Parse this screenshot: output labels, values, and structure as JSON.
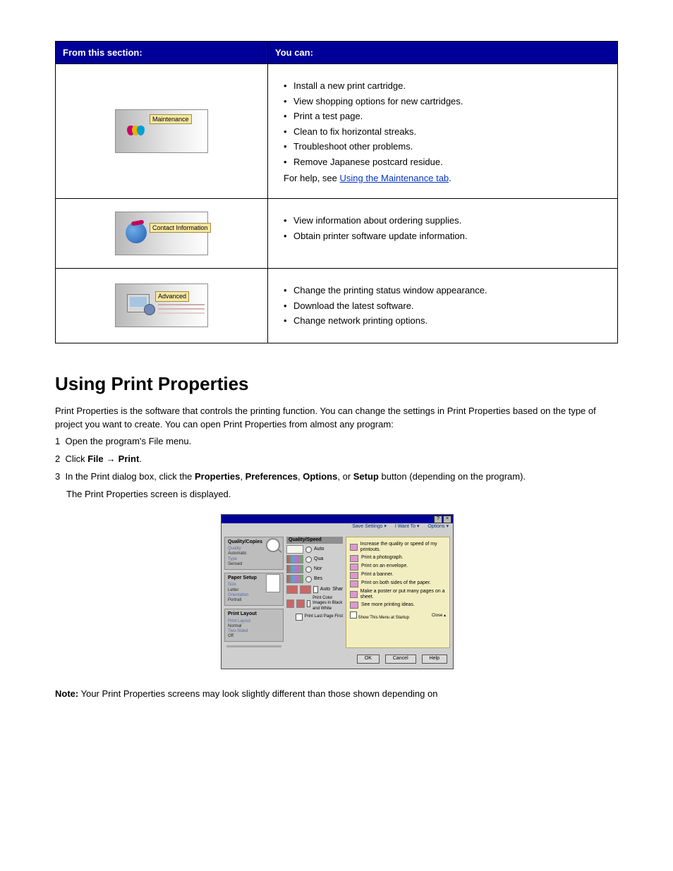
{
  "table": {
    "header": {
      "from": "From this section:",
      "can": "You can:"
    },
    "rows": [
      {
        "icon": "maintenance-icon",
        "label": "Maintenance",
        "items": [
          "Install a new print cartridge.",
          "View shopping options for new cartridges.",
          "Print a test page.",
          "Clean to fix horizontal streaks.",
          "Troubleshoot other problems.",
          "Remove Japanese postcard residue."
        ],
        "helpNote": "For help, see ",
        "helpLink": "Using the Maintenance tab"
      },
      {
        "icon": "contact-information-icon",
        "label": "Contact Information",
        "items": [
          "View information about ordering supplies.",
          "Obtain printer software update information."
        ]
      },
      {
        "icon": "advanced-icon",
        "label": "Advanced",
        "items": [
          "Change the printing status window appearance.",
          "Download the latest software.",
          "Change network printing options."
        ]
      }
    ]
  },
  "sectionTitle": "Using Print Properties",
  "paragraph1": "Print Properties is the software that controls the printing function. You can change the settings in Print Properties based on the type of project you want to create. You can open Print Properties from almost any program:",
  "steps": {
    "s1_label": "1",
    "s1_text": "Open the program's File menu.",
    "s2_label": "2",
    "s2_text_a": "Click ",
    "s2_text_b": "File",
    "s2_arrow": "→",
    "s2_text_c": "Print",
    "s2_text_d": ".",
    "s3_label": "3",
    "s3_text_a": "In the Print dialog box, click the ",
    "s3_text_b": "Properties",
    "s3_text_c": ", ",
    "s3_text_d": "Preferences",
    "s3_text_e": ", ",
    "s3_text_f": "Options",
    "s3_text_g": ", or ",
    "s3_text_h": "Setup",
    "s3_text_i": " button (depending on the program).",
    "s3_text_j": "The Print Properties screen is displayed."
  },
  "dialog": {
    "winbuttons": {
      "help": "?",
      "close": "×"
    },
    "menubar": {
      "save": "Save Settings ▾",
      "iwant": "I Want To ▾",
      "options": "Options ▾"
    },
    "side": {
      "qc_head": "Quality/Copies",
      "qc_l1": "Quality",
      "qc_v1": "Automatic",
      "qc_l2": "Type",
      "qc_v2": "Sensed",
      "ps_head": "Paper Setup",
      "ps_l1": "Size",
      "ps_v1": "Letter",
      "ps_l2": "Orientation",
      "ps_v2": "Portrait",
      "pl_head": "Print Layout",
      "pl_l1": "Print Layout",
      "pl_v1": "Normal",
      "pl_l2": "Two-Sided",
      "pl_v2": "Off"
    },
    "mid": {
      "head": "Quality/Speed",
      "r1": "Auto",
      "r2": "Qua",
      "r3": "Nor",
      "r4": "Bes",
      "row2a": "Auto",
      "row2b": "Shar",
      "row3": "Print Color Images in Black and White",
      "row3chk": "Print Last Page First"
    },
    "iwant": {
      "i1": "Increase the quality or speed of my printouts.",
      "i2": "Print a photograph.",
      "i3": "Print on an envelope.",
      "i4": "Print a banner.",
      "i5": "Print on both sides of the paper.",
      "i6": "Make a poster or put many pages on a sheet.",
      "i7": "See more printing ideas.",
      "showchk": "Show This Menu at Startup",
      "close": "Close ▴"
    },
    "buttons": {
      "ok": "OK",
      "cancel": "Cancel",
      "help": "Help"
    }
  },
  "note": {
    "label": "Note:",
    "text": "Your Print Properties screens may look slightly different than those shown depending on"
  }
}
